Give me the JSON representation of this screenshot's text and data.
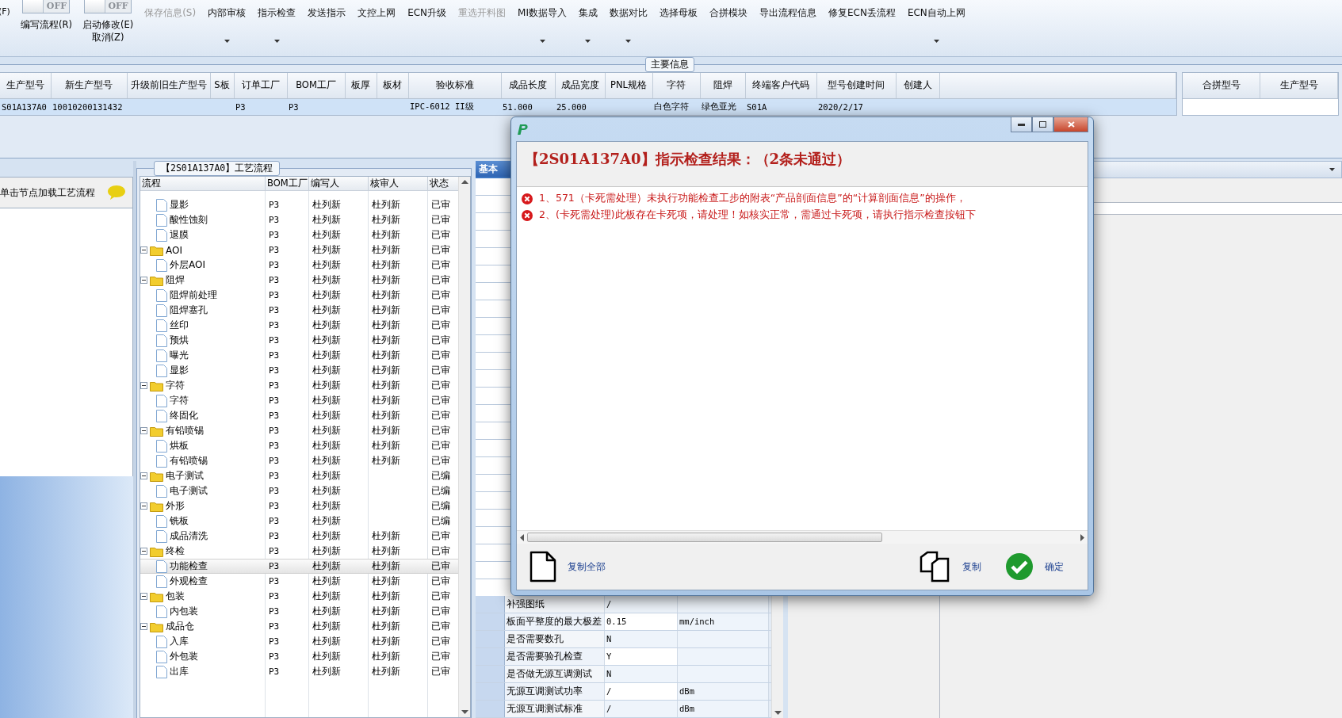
{
  "toolbar": {
    "cut_label": "(F)",
    "toggles": [
      {
        "state_text": "OFF",
        "on": false,
        "label": "编写流程(R)"
      },
      {
        "state_text": "OFF",
        "on": false,
        "label": "启动修改(E)",
        "sub_label": "取消(Z)"
      }
    ],
    "buttons": [
      {
        "label": "保存信息(S)",
        "disabled": true,
        "dropdown": false
      },
      {
        "label": "内部审核",
        "disabled": false,
        "dropdown": true
      },
      {
        "label": "指示检查",
        "disabled": false,
        "dropdown": true
      },
      {
        "label": "发送指示",
        "disabled": false,
        "dropdown": false
      },
      {
        "label": "文控上网",
        "disabled": false,
        "dropdown": false
      },
      {
        "label": "ECN升级",
        "disabled": false,
        "dropdown": false
      },
      {
        "label": "重选开料图",
        "disabled": true,
        "dropdown": false
      },
      {
        "label": "MI数据导入",
        "disabled": false,
        "dropdown": true
      },
      {
        "label": "集成",
        "disabled": false,
        "dropdown": true
      },
      {
        "label": "数据对比",
        "disabled": false,
        "dropdown": true
      },
      {
        "label": "选择母板",
        "disabled": false,
        "dropdown": false
      },
      {
        "label": "合拼模块",
        "disabled": false,
        "dropdown": false
      },
      {
        "label": "导出流程信息",
        "disabled": false,
        "dropdown": false
      },
      {
        "label": "修复ECN丢流程",
        "disabled": false,
        "dropdown": false
      },
      {
        "label": "ECN自动上网",
        "disabled": false,
        "dropdown": true
      }
    ]
  },
  "main_info": {
    "title": "主要信息",
    "columns": [
      "生产型号",
      "新生产型号",
      "升级前旧生产型号",
      "S板",
      "订单工厂",
      "BOM工厂",
      "板厚",
      "板材",
      "验收标准",
      "成品长度",
      "成品宽度",
      "PNL规格",
      "字符",
      "阻焊",
      "终端客户代码",
      "型号创建时间",
      "创建人"
    ],
    "rows": [
      {
        "selected": true,
        "cells": [
          "S01A137A0",
          "10010200131432",
          null,
          null,
          "P3",
          "P3",
          null,
          null,
          "IPC-6012 II级",
          "51.000",
          "25.000",
          null,
          "白色字符",
          "绿色亚光",
          "S01A",
          "2020/2/17",
          null
        ]
      }
    ],
    "side_columns": [
      "合拼型号",
      "生产型号"
    ]
  },
  "left_panel": {
    "hint": "单击节点加载工艺流程"
  },
  "process_tree": {
    "title": "【2S01A137A0】工艺流程",
    "columns": [
      "流程",
      "BOM工厂",
      "编写人",
      "核审人",
      "状态"
    ],
    "nodes": [
      {
        "kind": "partial",
        "children": [
          {
            "kind": "step",
            "label": "显影",
            "bom": "P3",
            "writer": "杜列新",
            "reviewer": "杜列新",
            "status": "已审",
            "selected": false
          },
          {
            "kind": "step",
            "label": "酸性蚀刻",
            "bom": "P3",
            "writer": "杜列新",
            "reviewer": "杜列新",
            "status": "已审",
            "selected": false
          },
          {
            "kind": "step",
            "label": "退膜",
            "bom": "P3",
            "writer": "杜列新",
            "reviewer": "杜列新",
            "status": "已审",
            "selected": false
          }
        ]
      },
      {
        "kind": "folder",
        "label": "AOI",
        "bom": "P3",
        "writer": "杜列新",
        "reviewer": "杜列新",
        "status": "已审",
        "selected": false,
        "expanded": true,
        "children": [
          {
            "kind": "step",
            "label": "外层AOI",
            "bom": "P3",
            "writer": "杜列新",
            "reviewer": "杜列新",
            "status": "已审",
            "selected": false
          }
        ]
      },
      {
        "kind": "folder",
        "label": "阻焊",
        "bom": "P3",
        "writer": "杜列新",
        "reviewer": "杜列新",
        "status": "已审",
        "selected": false,
        "expanded": true,
        "children": [
          {
            "kind": "step",
            "label": "阻焊前处理",
            "bom": "P3",
            "writer": "杜列新",
            "reviewer": "杜列新",
            "status": "已审",
            "selected": false
          },
          {
            "kind": "step",
            "label": "阻焊塞孔",
            "bom": "P3",
            "writer": "杜列新",
            "reviewer": "杜列新",
            "status": "已审",
            "selected": false
          },
          {
            "kind": "step",
            "label": "丝印",
            "bom": "P3",
            "writer": "杜列新",
            "reviewer": "杜列新",
            "status": "已审",
            "selected": false
          },
          {
            "kind": "step",
            "label": "预烘",
            "bom": "P3",
            "writer": "杜列新",
            "reviewer": "杜列新",
            "status": "已审",
            "selected": false
          },
          {
            "kind": "step",
            "label": "曝光",
            "bom": "P3",
            "writer": "杜列新",
            "reviewer": "杜列新",
            "status": "已审",
            "selected": false
          },
          {
            "kind": "step",
            "label": "显影",
            "bom": "P3",
            "writer": "杜列新",
            "reviewer": "杜列新",
            "status": "已审",
            "selected": false
          }
        ]
      },
      {
        "kind": "folder",
        "label": "字符",
        "bom": "P3",
        "writer": "杜列新",
        "reviewer": "杜列新",
        "status": "已审",
        "selected": false,
        "expanded": true,
        "children": [
          {
            "kind": "step",
            "label": "字符",
            "bom": "P3",
            "writer": "杜列新",
            "reviewer": "杜列新",
            "status": "已审",
            "selected": false
          },
          {
            "kind": "step",
            "label": "终固化",
            "bom": "P3",
            "writer": "杜列新",
            "reviewer": "杜列新",
            "status": "已审",
            "selected": false
          }
        ]
      },
      {
        "kind": "folder",
        "label": "有铅喷锡",
        "bom": "P3",
        "writer": "杜列新",
        "reviewer": "杜列新",
        "status": "已审",
        "selected": false,
        "expanded": true,
        "children": [
          {
            "kind": "step",
            "label": "烘板",
            "bom": "P3",
            "writer": "杜列新",
            "reviewer": "杜列新",
            "status": "已审",
            "selected": false
          },
          {
            "kind": "step",
            "label": "有铅喷锡",
            "bom": "P3",
            "writer": "杜列新",
            "reviewer": "杜列新",
            "status": "已审",
            "selected": false
          }
        ]
      },
      {
        "kind": "folder",
        "label": "电子测试",
        "bom": "P3",
        "writer": "杜列新",
        "status": "已编",
        "selected": false,
        "expanded": true,
        "children": [
          {
            "kind": "step",
            "label": "电子测试",
            "bom": "P3",
            "writer": "杜列新",
            "status": "已编",
            "selected": false
          }
        ]
      },
      {
        "kind": "folder",
        "label": "外形",
        "bom": "P3",
        "writer": "杜列新",
        "status": "已编",
        "selected": false,
        "expanded": true,
        "children": [
          {
            "kind": "step",
            "label": "铣板",
            "bom": "P3",
            "writer": "杜列新",
            "status": "已编",
            "selected": false
          },
          {
            "kind": "step",
            "label": "成品清洗",
            "bom": "P3",
            "writer": "杜列新",
            "reviewer": "杜列新",
            "status": "已审",
            "selected": false
          }
        ]
      },
      {
        "kind": "folder",
        "label": "终检",
        "bom": "P3",
        "writer": "杜列新",
        "reviewer": "杜列新",
        "status": "已审",
        "selected": false,
        "expanded": true,
        "children": [
          {
            "kind": "step",
            "label": "功能检查",
            "bom": "P3",
            "writer": "杜列新",
            "reviewer": "杜列新",
            "status": "已审",
            "selected": true
          },
          {
            "kind": "step",
            "label": "外观检查",
            "bom": "P3",
            "writer": "杜列新",
            "reviewer": "杜列新",
            "status": "已审",
            "selected": false
          }
        ]
      },
      {
        "kind": "folder",
        "label": "包装",
        "bom": "P3",
        "writer": "杜列新",
        "reviewer": "杜列新",
        "status": "已审",
        "selected": false,
        "expanded": true,
        "children": [
          {
            "kind": "step",
            "label": "内包装",
            "bom": "P3",
            "writer": "杜列新",
            "reviewer": "杜列新",
            "status": "已审",
            "selected": false
          }
        ]
      },
      {
        "kind": "folder",
        "label": "成品仓",
        "bom": "P3",
        "writer": "杜列新",
        "reviewer": "杜列新",
        "status": "已审",
        "selected": false,
        "expanded": true,
        "children": [
          {
            "kind": "step",
            "label": "入库",
            "bom": "P3",
            "writer": "杜列新",
            "reviewer": "杜列新",
            "status": "已审",
            "selected": false
          },
          {
            "kind": "step",
            "label": "外包装",
            "bom": "P3",
            "writer": "杜列新",
            "reviewer": "杜列新",
            "status": "已审",
            "selected": false
          },
          {
            "kind": "step",
            "label": "出库",
            "bom": "P3",
            "writer": "杜列新",
            "reviewer": "杜列新",
            "status": "已审",
            "selected": false
          }
        ]
      }
    ]
  },
  "detail_panel": {
    "tab": "基本",
    "rows": [
      {
        "name": "补强图纸",
        "value": "/"
      },
      {
        "name": "板面平整度的最大极差",
        "value": "0.15",
        "unit": "mm/inch"
      },
      {
        "name": "是否需要数孔",
        "value": "N"
      },
      {
        "name": "是否需要验孔检查",
        "value": "Y"
      },
      {
        "name": "是否做无源互调测试",
        "value": "N"
      },
      {
        "name": "无源互调测试功率",
        "value": "/",
        "unit": "dBm"
      },
      {
        "name": "无源互调测试标准",
        "value": "/",
        "unit": "dBm"
      }
    ]
  },
  "dialog": {
    "title": "【2S01A137A0】指示检查结果：（2条未通过）",
    "messages": [
      {
        "kind": "error",
        "text": "1、571（卡死需处理）未执行功能检查工步的附表“产品剖面信息”的“计算剖面信息”的操作，"
      },
      {
        "kind": "error",
        "text": "2、(卡死需处理)此板存在卡死项，请处理！如核实正常，需通过卡死项，请执行指示检查按钮下"
      }
    ],
    "buttons": [
      {
        "kind": "copy_all",
        "label": "复制全部"
      },
      {
        "kind": "copy",
        "label": "复制"
      },
      {
        "kind": "ok",
        "label": "确定"
      }
    ]
  }
}
